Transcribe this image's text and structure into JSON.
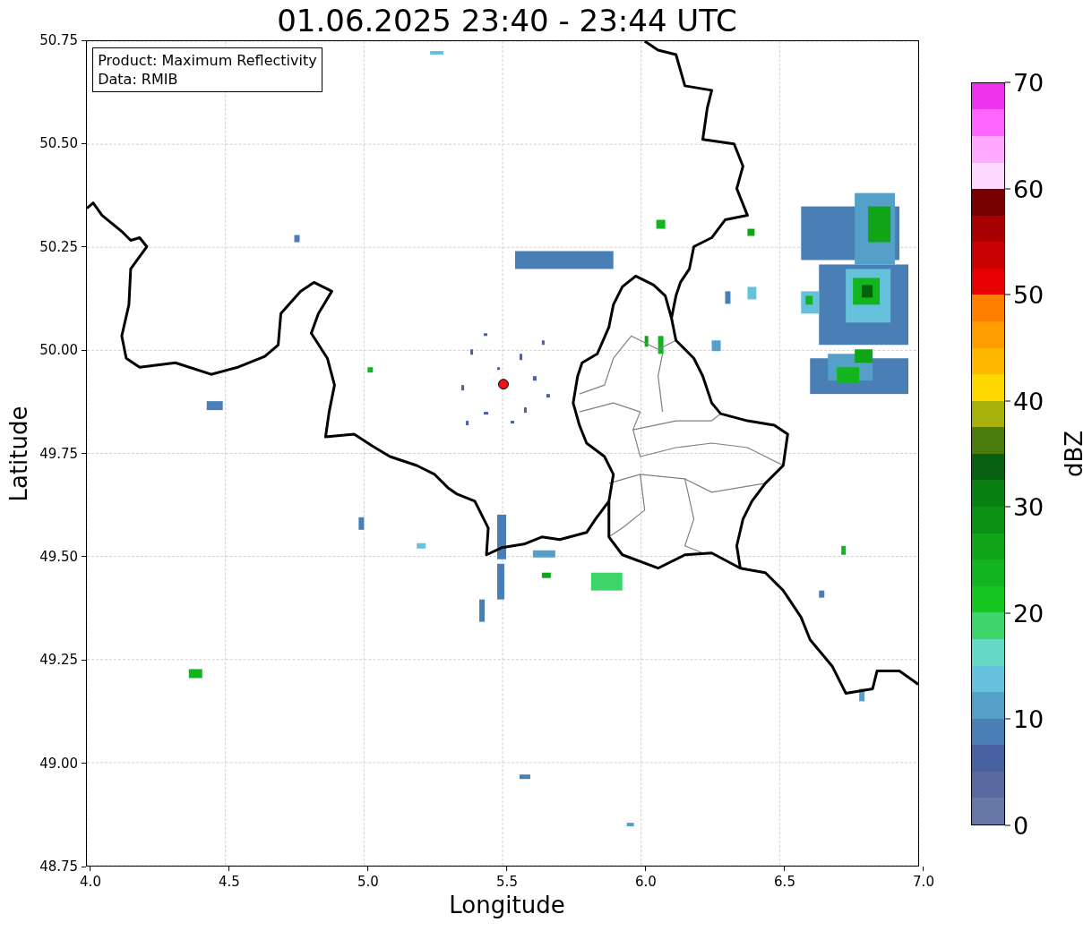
{
  "title": "01.06.2025 23:40 - 23:44 UTC",
  "map": {
    "annotation": [
      "Product: Maximum Reflectivity",
      "Data: RMIB"
    ],
    "xlabel": "Longitude",
    "ylabel": "Latitude",
    "xticks": [
      "4.0",
      "4.5",
      "5.0",
      "5.5",
      "6.0",
      "6.5",
      "7.0"
    ],
    "yticks": [
      "50.75",
      "50.50",
      "50.25",
      "50.00",
      "49.75",
      "49.50",
      "49.25",
      "49.00",
      "48.75"
    ]
  },
  "colorbar": {
    "label": "dBZ",
    "ticks": [
      "70",
      "60",
      "50",
      "40",
      "30",
      "20",
      "10",
      "0"
    ],
    "bins": [
      {
        "color": "#6677a8"
      },
      {
        "color": "#5a6aa0"
      },
      {
        "color": "#4760a0"
      },
      {
        "color": "#4a7fb5"
      },
      {
        "color": "#55a0c8"
      },
      {
        "color": "#66c2dc"
      },
      {
        "color": "#66d8c8"
      },
      {
        "color": "#3dd46a"
      },
      {
        "color": "#15c520"
      },
      {
        "color": "#12b51e"
      },
      {
        "color": "#0fa517"
      },
      {
        "color": "#0b9014"
      },
      {
        "color": "#0a7f12"
      },
      {
        "color": "#056010"
      },
      {
        "color": "#4a7a0a"
      },
      {
        "color": "#a8b00a"
      },
      {
        "color": "#ffd700"
      },
      {
        "color": "#ffb800"
      },
      {
        "color": "#ff9c00"
      },
      {
        "color": "#ff7f00"
      },
      {
        "color": "#e60000"
      },
      {
        "color": "#c80000"
      },
      {
        "color": "#a80000"
      },
      {
        "color": "#780000"
      },
      {
        "color": "#ffd8ff"
      },
      {
        "color": "#ffaaff"
      },
      {
        "color": "#ff66ff"
      },
      {
        "color": "#ee33ee"
      }
    ]
  }
}
